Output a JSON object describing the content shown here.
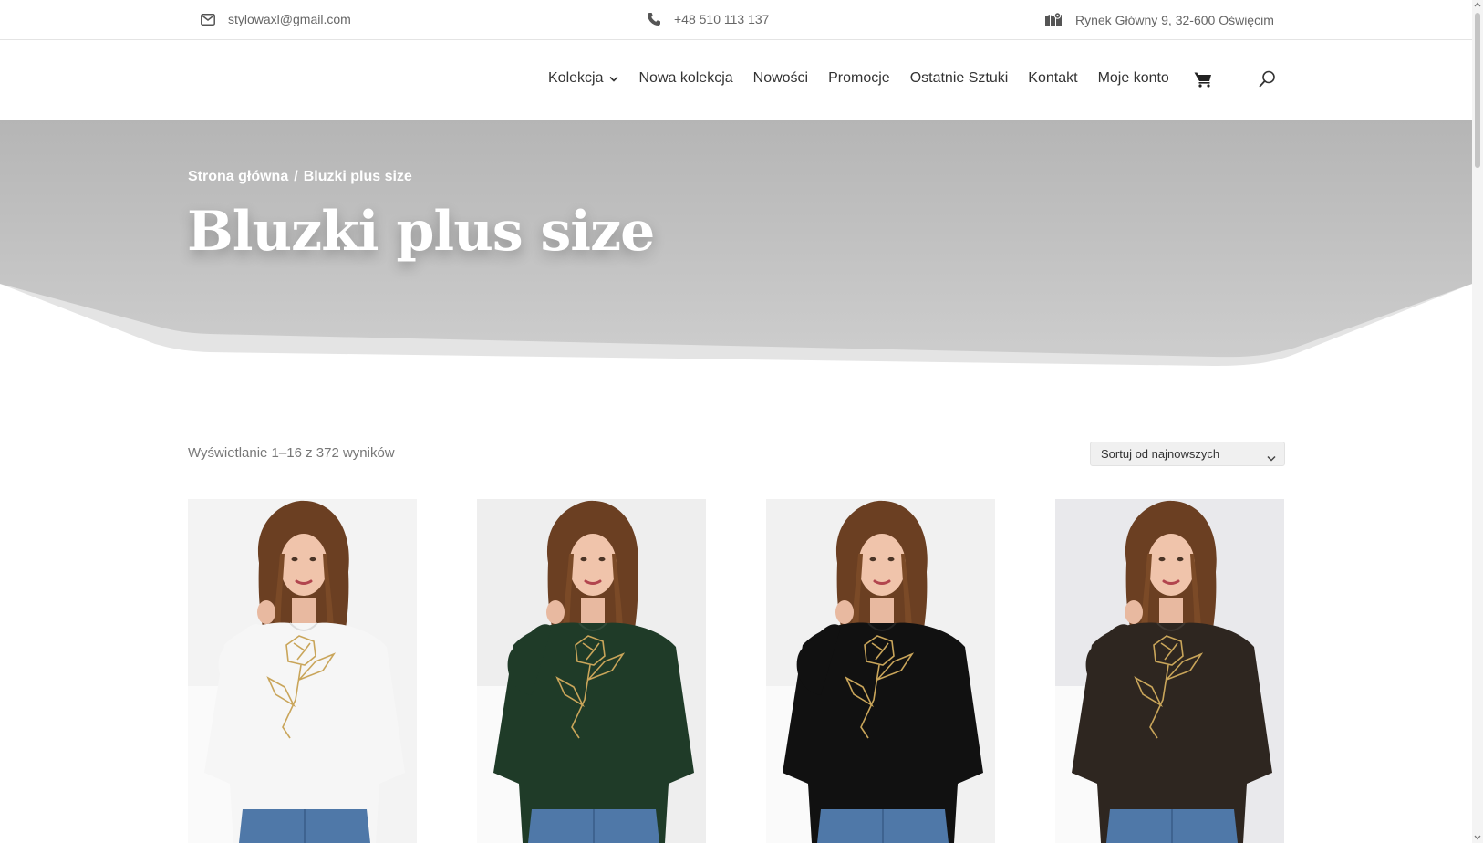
{
  "topbar": {
    "email": "stylowaxl@gmail.com",
    "phone": "+48 510 113 137",
    "address": "Rynek Główny 9, 32-600 Oświęcim"
  },
  "nav": {
    "items": [
      {
        "label": "Kolekcja"
      },
      {
        "label": "Nowa kolekcja"
      },
      {
        "label": "Nowości"
      },
      {
        "label": "Promocje"
      },
      {
        "label": "Ostatnie Sztuki"
      },
      {
        "label": "Kontakt"
      },
      {
        "label": "Moje konto"
      }
    ],
    "icons": [
      "cart-icon",
      "search-icon"
    ]
  },
  "breadcrumb": {
    "home": "Strona główna",
    "separator": "/",
    "current": "Bluzki plus size"
  },
  "page": {
    "title": "Bluzki plus size"
  },
  "results": {
    "count_text": "Wyświetlanie 1–16 z 372 wyników",
    "sort_selected": "Sortuj od najnowszych"
  },
  "products": [
    {
      "shirt_color": "#f6f6f6"
    },
    {
      "shirt_color": "#1f3b28"
    },
    {
      "shirt_color": "#111111"
    },
    {
      "shirt_color": "#2e2620"
    }
  ],
  "colors": {
    "hero_bg": "#bdbdbd",
    "hero_bg_light": "#e6e6e6",
    "text_dark": "#333333",
    "text_muted": "#777777",
    "print_gold": "#c9a55a"
  }
}
